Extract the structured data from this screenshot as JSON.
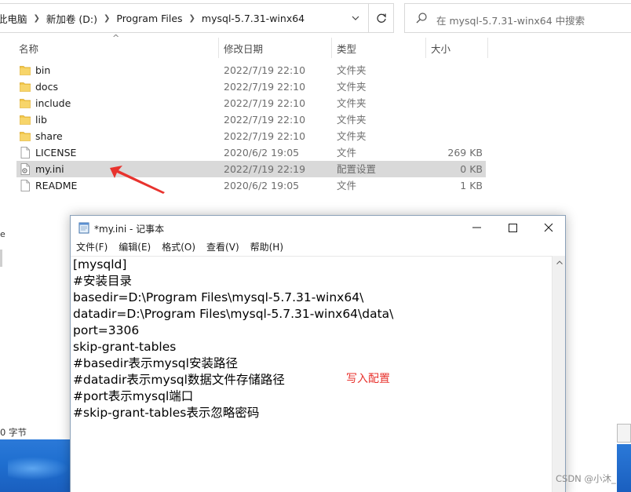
{
  "explorer": {
    "breadcrumb": [
      "此电脑",
      "新加卷 (D:)",
      "Program Files",
      "mysql-5.7.31-winx64"
    ],
    "search_placeholder": "在 mysql-5.7.31-winx64 中搜索",
    "columns": {
      "name": "名称",
      "date": "修改日期",
      "type": "类型",
      "size": "大小"
    },
    "files": [
      {
        "name": "bin",
        "date": "2022/7/19 22:10",
        "type": "文件夹",
        "size": "",
        "icon": "folder-icon"
      },
      {
        "name": "docs",
        "date": "2022/7/19 22:10",
        "type": "文件夹",
        "size": "",
        "icon": "folder-icon"
      },
      {
        "name": "include",
        "date": "2022/7/19 22:10",
        "type": "文件夹",
        "size": "",
        "icon": "folder-icon"
      },
      {
        "name": "lib",
        "date": "2022/7/19 22:10",
        "type": "文件夹",
        "size": "",
        "icon": "folder-icon"
      },
      {
        "name": "share",
        "date": "2022/7/19 22:10",
        "type": "文件夹",
        "size": "",
        "icon": "folder-icon"
      },
      {
        "name": "LICENSE",
        "date": "2020/6/2 19:05",
        "type": "文件",
        "size": "269 KB",
        "icon": "file-icon"
      },
      {
        "name": "my.ini",
        "date": "2022/7/19 22:19",
        "type": "配置设置",
        "size": "0 KB",
        "icon": "settings-file-icon",
        "selected": true
      },
      {
        "name": "README",
        "date": "2020/6/2 19:05",
        "type": "文件",
        "size": "1 KB",
        "icon": "file-icon"
      }
    ],
    "status_text": "0 字节",
    "left_fragment_text": "e",
    "colors": {
      "selection": "#d9d9d9",
      "folder": "#f3c84b",
      "arrow": "#e8332e"
    }
  },
  "notepad": {
    "title": "*my.ini - 记事本",
    "menu": [
      "文件(F)",
      "编辑(E)",
      "格式(O)",
      "查看(V)",
      "帮助(H)"
    ],
    "lines": [
      "[mysqld]",
      "#安装目录",
      "basedir=D:\\Program Files\\mysql-5.7.31-winx64\\",
      "datadir=D:\\Program Files\\mysql-5.7.31-winx64\\data\\",
      "port=3306",
      "skip-grant-tables",
      "#basedir表示mysql安装路径",
      "#datadir表示mysql数据文件存储路径",
      "#port表示mysql端口",
      "#skip-grant-tables表示忽略密码"
    ],
    "annotation": "写入配置"
  },
  "watermark": "CSDN @小沐_"
}
